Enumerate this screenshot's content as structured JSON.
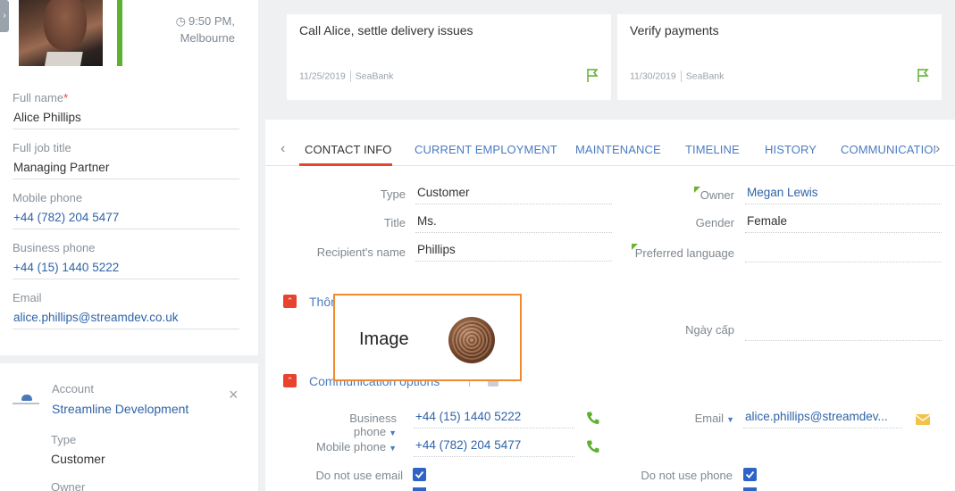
{
  "profile": {
    "time": "9:50 PM,",
    "city": "Melbourne",
    "status_color": "#5cb22e"
  },
  "contact": {
    "full_name_label": "Full name",
    "required_mark": "*",
    "full_name": "Alice Phillips",
    "job_title_label": "Full job title",
    "job_title": "Managing Partner",
    "mobile_label": "Mobile phone",
    "mobile": "+44 (782) 204 5477",
    "business_label": "Business phone",
    "business": "+44 (15) 1440 5222",
    "email_label": "Email",
    "email": "alice.phillips@streamdev.co.uk"
  },
  "account": {
    "label": "Account",
    "name": "Streamline Development",
    "type_label": "Type",
    "type": "Customer",
    "owner_label": "Owner"
  },
  "tasks": [
    {
      "title": "Call Alice, settle delivery issues",
      "date": "11/25/2019",
      "source": "SeaBank"
    },
    {
      "title": "Verify payments",
      "date": "11/30/2019",
      "source": "SeaBank"
    }
  ],
  "tabs": [
    {
      "label": "CONTACT INFO",
      "active": true
    },
    {
      "label": "CURRENT EMPLOYMENT"
    },
    {
      "label": "MAINTENANCE"
    },
    {
      "label": "TIMELINE"
    },
    {
      "label": "HISTORY"
    },
    {
      "label": "COMMUNICATION"
    }
  ],
  "info": {
    "type_label": "Type",
    "type": "Customer",
    "title_label": "Title",
    "title": "Ms.",
    "recipient_label": "Recipient's name",
    "recipient": "Phillips",
    "owner_label": "Owner",
    "owner": "Megan Lewis",
    "gender_label": "Gender",
    "gender": "Female",
    "language_label": "Preferred language",
    "language": ""
  },
  "sections": {
    "personal_title": "Thông tin nhân thân",
    "issue_date_label": "Ngày cấp",
    "comm_title": "Communication options"
  },
  "image_overlay": {
    "label": "Image"
  },
  "comm": {
    "business_label": "Business phone",
    "business": "+44 (15) 1440 5222",
    "mobile_label": "Mobile phone",
    "mobile": "+44 (782) 204 5477",
    "email_label": "Email",
    "email": "alice.phillips@streamdev...",
    "no_email_label": "Do not use email",
    "no_phone_label": "Do not use phone"
  },
  "colors": {
    "accent": "#e8432e",
    "link": "#2f63a8",
    "green": "#5cb22e",
    "checkbox": "#2f63c8"
  }
}
